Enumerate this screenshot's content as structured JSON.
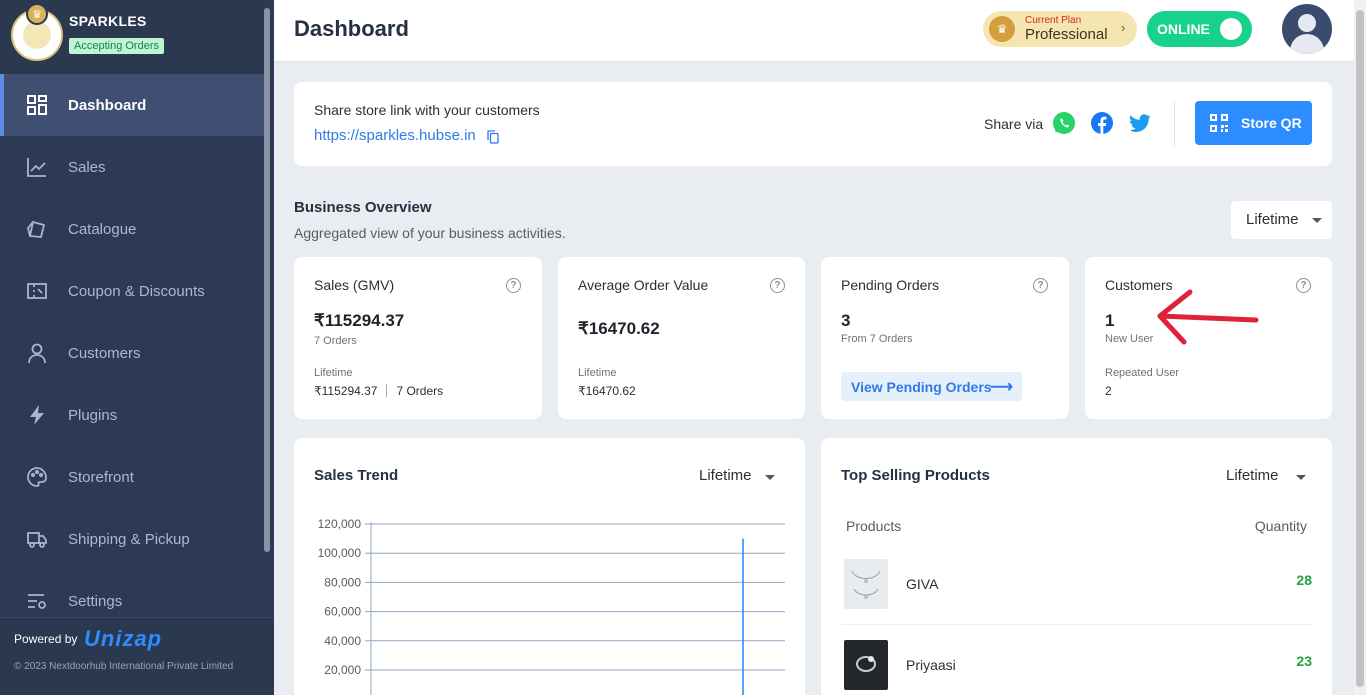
{
  "store": {
    "name": "SPARKLES",
    "status": "Accepting Orders"
  },
  "sidebar": {
    "items": [
      {
        "label": "Dashboard",
        "icon": "dashboard-icon",
        "active": true
      },
      {
        "label": "Sales",
        "icon": "trend-chart-icon"
      },
      {
        "label": "Catalogue",
        "icon": "catalogue-icon"
      },
      {
        "label": "Coupon & Discounts",
        "icon": "coupon-icon"
      },
      {
        "label": "Customers",
        "icon": "user-icon"
      },
      {
        "label": "Plugins",
        "icon": "lightning-icon"
      },
      {
        "label": "Storefront",
        "icon": "palette-icon"
      },
      {
        "label": "Shipping & Pickup",
        "icon": "truck-icon"
      },
      {
        "label": "Settings",
        "icon": "settings-list-icon"
      }
    ],
    "powered_by": "Powered by",
    "brand": "Unizap",
    "copyright": "© 2023 Nextdoorhub International Private Limited"
  },
  "header": {
    "title": "Dashboard",
    "plan_caption": "Current Plan",
    "plan_name": "Professional",
    "online_label": "ONLINE",
    "online": true
  },
  "share": {
    "title": "Share store link with your customers",
    "link": "https://sparkles.hubse.in",
    "share_via": "Share via",
    "qr_label": "Store QR",
    "social_icons": [
      "whatsapp-icon",
      "facebook-icon",
      "twitter-icon"
    ]
  },
  "overview": {
    "title": "Business Overview",
    "subtitle": "Aggregated view of your business activities.",
    "period": "Lifetime"
  },
  "stats": {
    "sales": {
      "title": "Sales (GMV)",
      "value": "₹115294.37",
      "orders": "7 Orders",
      "period_label": "Lifetime",
      "period_value": "₹115294.37",
      "period_orders": "7 Orders"
    },
    "aov": {
      "title": "Average Order Value",
      "value": "₹16470.62",
      "period_label": "Lifetime",
      "period_value": "₹16470.62"
    },
    "pending": {
      "title": "Pending Orders",
      "value": "3",
      "from": "From 7 Orders",
      "link": "View Pending Orders"
    },
    "customers": {
      "title": "Customers",
      "value": "1",
      "value_label": "New User",
      "repeat_label": "Repeated User",
      "repeat_value": "2"
    }
  },
  "sales_trend": {
    "title": "Sales Trend",
    "period": "Lifetime"
  },
  "top_products": {
    "title": "Top Selling Products",
    "period": "Lifetime",
    "col_products": "Products",
    "col_quantity": "Quantity",
    "rows": [
      {
        "name": "GIVA",
        "qty": "28"
      },
      {
        "name": "Priyaasi",
        "qty": "23"
      }
    ]
  },
  "colors": {
    "sidebar": "#2c3a55",
    "accent": "#2d8cff",
    "online": "#18d18b",
    "quantity": "#23a23f",
    "annotation": "#e0213a"
  },
  "chart_data": {
    "type": "line",
    "title": "Sales Trend",
    "xlabel": "",
    "ylabel": "",
    "ylim": [
      0,
      120000
    ],
    "yticks": [
      "20,000",
      "40,000",
      "60,000",
      "80,000",
      "100,000",
      "120,000"
    ],
    "grid": true,
    "series": [
      {
        "values": [
          0,
          0,
          0,
          0,
          0,
          0,
          0,
          0,
          0,
          0,
          0,
          0,
          110000
        ]
      }
    ]
  }
}
